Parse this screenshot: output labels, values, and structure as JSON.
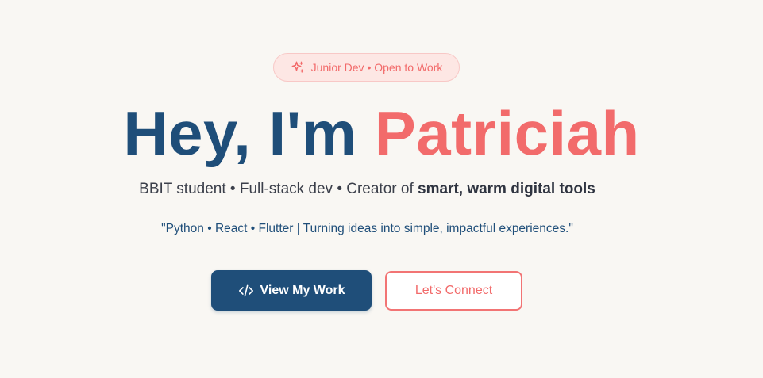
{
  "badge": {
    "icon": "sparkle-icon",
    "label": "Junior Dev • Open to Work"
  },
  "headline": {
    "greeting": "Hey, I'm ",
    "name": "Patriciah"
  },
  "subtitle": {
    "prefix": "BBIT student • Full-stack dev • Creator of ",
    "highlight": "smart, warm digital tools"
  },
  "quote": "\"Python • React • Flutter | Turning ideas into simple, impactful experiences.\"",
  "buttons": {
    "primary": {
      "icon": "code-icon",
      "label": "View My Work"
    },
    "secondary": {
      "label": "Let's Connect"
    }
  },
  "colors": {
    "background": "#f9f7f3",
    "primary": "#1f4e79",
    "accent": "#f26b6b",
    "badge_bg": "#fde7e4"
  }
}
